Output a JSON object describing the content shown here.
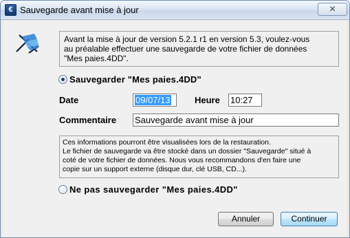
{
  "window": {
    "title": "Sauvegarde avant mise à jour",
    "close_glyph": "✕"
  },
  "icons": {
    "app": "app-icon",
    "logo": "deckchair-logo-icon",
    "close": "close-icon"
  },
  "intro": {
    "line1": "Avant la mise à jour de version 5.2.1 r1 en version 5.3, voulez-vous",
    "line2": "au préalable effectuer une sauvegarde de votre fichier de données",
    "line3": "\"Mes paies.4DD\"."
  },
  "option_save": {
    "label": "Sauvegarder \"Mes paies.4DD\"",
    "checked": true
  },
  "fields": {
    "date_label": "Date",
    "date_value": "09/07/13",
    "heure_label": "Heure",
    "heure_value": "10:27",
    "comment_label": "Commentaire",
    "comment_value": "Sauvegarde avant mise à jour"
  },
  "info": {
    "line1": "Ces informations pourront être visualisées lors de la restauration.",
    "line2": "Le fichier de sauvegarde va être stocké dans un dossier \"Sauvegarde\" situé à",
    "line3": "coté de votre fichier de données. Nous vous recommandons d'en faire une",
    "line4": "copie sur un support externe (disque dur, clé USB, CD...)."
  },
  "option_nosave": {
    "label": "Ne pas sauvegarder \"Mes paies.4DD\"",
    "checked": false
  },
  "buttons": {
    "cancel": "Annuler",
    "continue": "Continuer"
  },
  "colors": {
    "selection": "#3399ff",
    "logo_blue": "#2a7fd4",
    "logo_dark": "#0e1e3c"
  }
}
